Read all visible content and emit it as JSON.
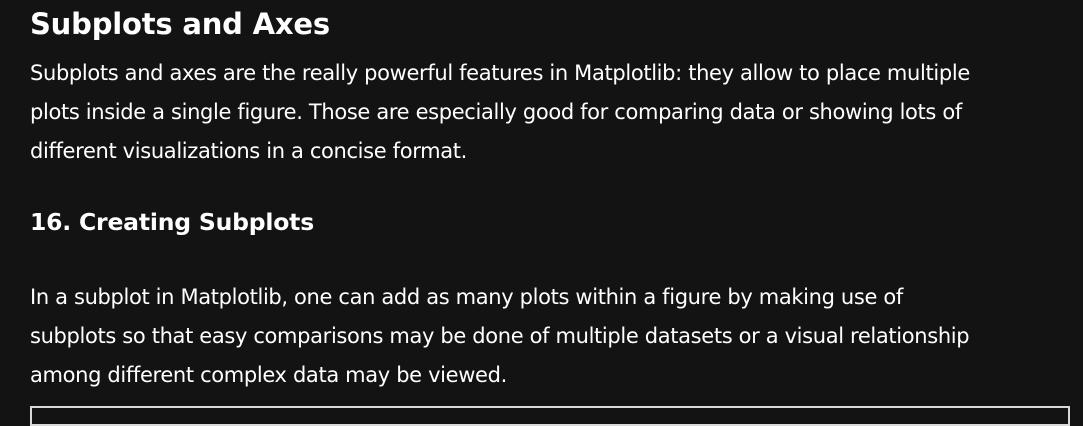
{
  "section": {
    "title": "Subplots and Axes",
    "intro_lines": [
      "Subplots and axes are the really powerful features in Matplotlib: they allow to place multiple",
      "plots inside a single figure. Those are especially good for comparing data or showing lots of",
      "different visualizations in a concise format."
    ]
  },
  "subsection": {
    "title": "16. Creating Subplots",
    "body_lines": [
      "In a subplot in Matplotlib, one can add as many plots within a figure by making use of",
      "subplots so that easy comparisons may be done of multiple datasets or a visual relationship",
      "among different complex data may be viewed."
    ]
  }
}
